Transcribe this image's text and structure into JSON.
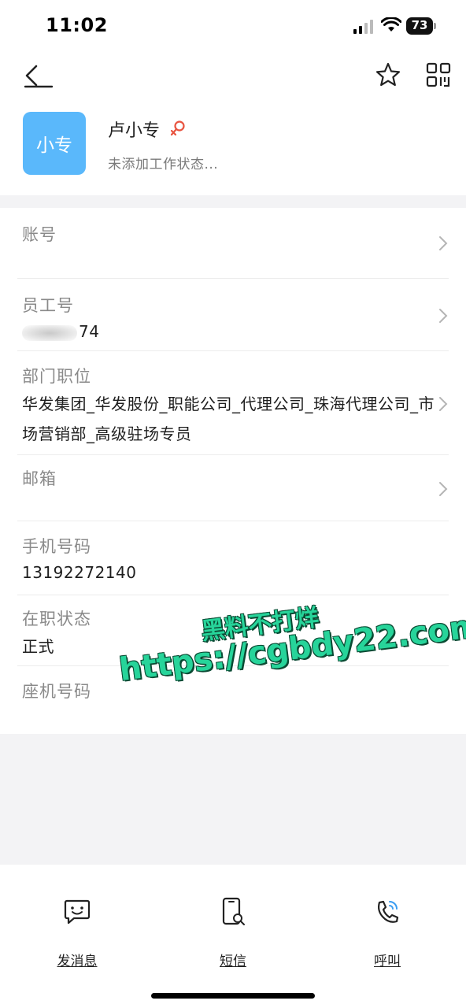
{
  "status_bar": {
    "time": "11:02",
    "battery": "73"
  },
  "nav": {
    "back_icon": "back-arrow-icon",
    "star_icon": "star-icon",
    "qr_icon": "qr-code-icon"
  },
  "profile": {
    "avatar_text": "小专",
    "avatar_color": "#5ab8fb",
    "name": "卢小专",
    "gender_icon": "female-icon",
    "status": "未添加工作状态..."
  },
  "fields": [
    {
      "label": "账号",
      "value": ""
    },
    {
      "label": "员工号",
      "value": "74"
    },
    {
      "label": "部门职位",
      "value": "华发集团_华发股份_职能公司_代理公司_珠海代理公司_市场营销部_高级驻场专员"
    },
    {
      "label": "邮箱",
      "value": ""
    },
    {
      "label": "手机号码",
      "value": "13192272140"
    },
    {
      "label": "在职状态",
      "value": "正式"
    },
    {
      "label": "座机号码",
      "value": ""
    }
  ],
  "actions": [
    {
      "label": "发消息",
      "icon": "message-icon"
    },
    {
      "label": "短信",
      "icon": "sms-icon"
    },
    {
      "label": "呼叫",
      "icon": "phone-call-icon"
    }
  ],
  "overlay": {
    "line1": "黑料不打烊",
    "line2": "https://cgbdy22.com",
    "color": "#27d49a"
  }
}
